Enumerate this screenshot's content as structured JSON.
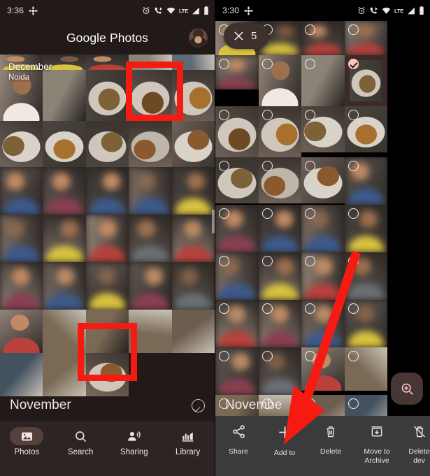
{
  "left_screen": {
    "status_bar": {
      "time": "3:36",
      "icons": [
        "grid-apps-icon",
        "alarm-icon",
        "call-wifi-icon",
        "wifi-icon",
        "signal-icon",
        "battery-icon"
      ],
      "network_label": "LTE"
    },
    "app_bar": {
      "title": "Google Photos",
      "avatar": "user-avatar"
    },
    "month_group": {
      "title": "December",
      "subtitle": "Noida"
    },
    "section_header": {
      "title": "November",
      "select_icon": "check-circle-icon"
    },
    "bottom_nav": {
      "items": [
        {
          "label": "Photos",
          "icon": "photos-icon",
          "active": true
        },
        {
          "label": "Search",
          "icon": "search-icon",
          "active": false
        },
        {
          "label": "Sharing",
          "icon": "sharing-icon",
          "active": false
        },
        {
          "label": "Library",
          "icon": "library-icon",
          "active": false
        }
      ]
    }
  },
  "right_screen": {
    "status_bar": {
      "time": "3:30",
      "network_label": "LTE"
    },
    "selection_chip": {
      "count": "5",
      "close_icon": "close-icon"
    },
    "section_header": {
      "title": "Novembe"
    },
    "fab": {
      "icon": "zoom-in-icon"
    },
    "action_bar": {
      "items": [
        {
          "label": "Share",
          "icon": "share-icon"
        },
        {
          "label": "Add to",
          "icon": "plus-icon"
        },
        {
          "label": "Delete",
          "icon": "trash-icon"
        },
        {
          "label": "Move to\nArchive",
          "icon": "archive-icon"
        },
        {
          "label": "Delete\ndev",
          "icon": "delete-device-icon"
        }
      ]
    }
  },
  "annotations": {
    "left_box_top": "highlight-box-photo-top",
    "left_box_bottom": "highlight-box-photo-bottom",
    "right_arrow": "arrow-pointing-to-add-to"
  },
  "colors": {
    "accent_red": "#f51b13",
    "selection_pink": "#f9c7c0",
    "left_bg": "#221a19",
    "nav_bg": "#2d2523",
    "action_bar_bg": "#3b3b3b"
  }
}
